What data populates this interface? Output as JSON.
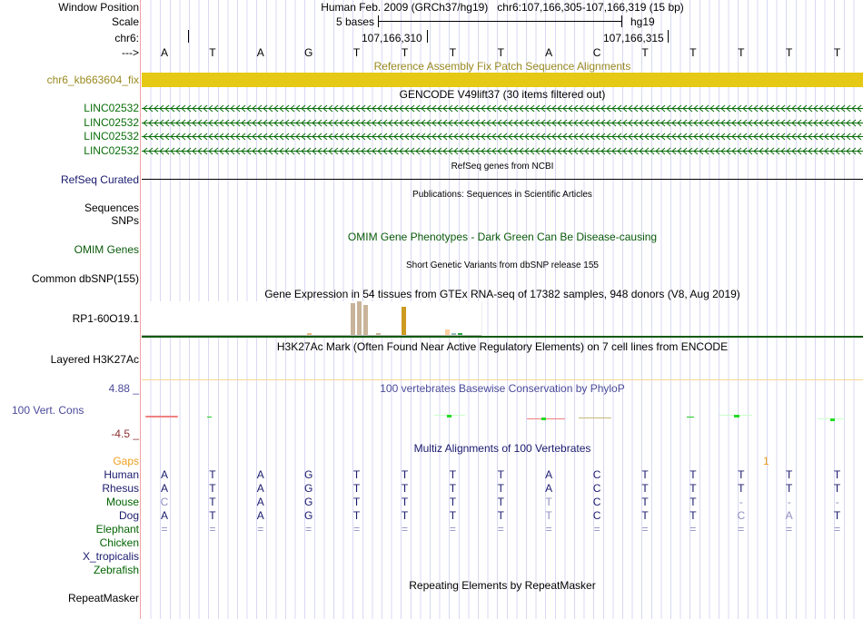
{
  "header": {
    "window_position_label": "Window Position",
    "window_position": "Human Feb. 2009 (GRCh37/hg19)   chr6:107,166,305-107,166,319 (15 bp)",
    "scale_label": "Scale",
    "scale_text": "5 bases",
    "assembly": "hg19",
    "chrom_label": "chr6:",
    "pos1": "107,166,310",
    "pos2": "107,166,315",
    "strand_label": "--->",
    "bases": [
      "A",
      "T",
      "A",
      "G",
      "T",
      "T",
      "T",
      "T",
      "A",
      "C",
      "T",
      "T",
      "T",
      "T",
      "T"
    ]
  },
  "tracks": {
    "fix_title": "Reference Assembly Fix Patch Sequence Alignments",
    "fix_label": "chr6_kb663604_fix",
    "gencode_title": "GENCODE V49lift37 (30 items filtered out)",
    "gencode_items": [
      "LINC02532",
      "LINC02532",
      "LINC02532",
      "LINC02532"
    ],
    "refseq_title": "RefSeq genes from NCBI",
    "refseq_label": "RefSeq Curated",
    "pubs_title": "Publications: Sequences in Scientific Articles",
    "pubs_label": "Sequences",
    "snps_label": "SNPs",
    "omim_title": "OMIM Gene Phenotypes - Dark Green Can Be Disease-causing",
    "omim_label": "OMIM Genes",
    "dbsnp_title": "Short Genetic Variants from dbSNP release 155",
    "dbsnp_label": "Common dbSNP(155)",
    "gtex_title": "Gene Expression in 54 tissues from GTEx RNA-seq of 17382 samples, 948 donors (V8, Aug 2019)",
    "gtex_label": "RP1-60O19.1",
    "h3k27_title": "H3K27Ac Mark (Often Found Near Active Regulatory Elements) on 7 cell lines from ENCODE",
    "h3k27_label": "Layered H3K27Ac",
    "phylop_title": "100 vertebrates Basewise Conservation by PhyloP",
    "phylop_label": "100 Vert. Cons",
    "phylop_max": "4.88 _",
    "phylop_min": "-4.5 _",
    "multiz_title": "Multiz Alignments of 100 Vertebrates",
    "gaps_label": "Gaps",
    "gaps_value": "1",
    "repeat_title": "Repeating Elements by RepeatMasker",
    "repeat_label": "RepeatMasker"
  },
  "gtex_bars": [
    {
      "tissue_index": 26,
      "value": 0.05,
      "color": "#e8b87c"
    },
    {
      "tissue_index": 33,
      "value": 0.95,
      "color": "#c9b49a"
    },
    {
      "tissue_index": 34,
      "value": 1.0,
      "color": "#c9b49a"
    },
    {
      "tissue_index": 35,
      "value": 0.88,
      "color": "#c9b49a"
    },
    {
      "tissue_index": 37,
      "value": 0.05,
      "color": "#c9b49a"
    },
    {
      "tissue_index": 41,
      "value": 0.85,
      "color": "#cc9a20"
    },
    {
      "tissue_index": 48,
      "value": 0.15,
      "color": "#ffd0a0"
    },
    {
      "tissue_index": 49,
      "value": 0.04,
      "color": "#99bbbb"
    },
    {
      "tissue_index": 50,
      "value": 0.05,
      "color": "#22aa44"
    }
  ],
  "multiz": [
    {
      "species": "Human",
      "color": "#1a1a6e",
      "bases": [
        "A",
        "T",
        "A",
        "G",
        "T",
        "T",
        "T",
        "T",
        "A",
        "C",
        "T",
        "T",
        "T",
        "T",
        "T"
      ],
      "faded": []
    },
    {
      "species": "Rhesus",
      "color": "#1a1a6e",
      "bases": [
        "A",
        "T",
        "A",
        "G",
        "T",
        "T",
        "T",
        "T",
        "A",
        "C",
        "T",
        "T",
        "T",
        "T",
        "T"
      ],
      "faded": []
    },
    {
      "species": "Mouse",
      "color": "#006400",
      "bases": [
        "C",
        "T",
        "A",
        "G",
        "T",
        "T",
        "T",
        "T",
        "T",
        "C",
        "T",
        "T",
        "-",
        "-",
        "-"
      ],
      "faded": [
        0,
        8,
        12,
        13,
        14
      ]
    },
    {
      "species": "Dog",
      "color": "#1a1a6e",
      "bases": [
        "A",
        "T",
        "A",
        "G",
        "T",
        "T",
        "T",
        "T",
        "T",
        "C",
        "T",
        "T",
        "C",
        "A",
        "T"
      ],
      "faded": [
        8,
        12,
        13
      ]
    },
    {
      "species": "Elephant",
      "color": "#006400",
      "bases": [
        "=",
        "=",
        "=",
        "=",
        "=",
        "=",
        "=",
        "=",
        "=",
        "=",
        "=",
        "=",
        "=",
        "=",
        "="
      ],
      "faded": [
        0,
        1,
        2,
        3,
        4,
        5,
        6,
        7,
        8,
        9,
        10,
        11,
        12,
        13,
        14
      ]
    },
    {
      "species": "Chicken",
      "color": "#006400",
      "bases": [],
      "faded": []
    },
    {
      "species": "X_tropicalis",
      "color": "#1a1a6e",
      "bases": [],
      "faded": []
    },
    {
      "species": "Zebrafish",
      "color": "#006400",
      "bases": [],
      "faded": []
    }
  ],
  "colors": {
    "fix": "#9a8a20",
    "gencode": "#0a6e0a",
    "refseq": "#1a1a6e",
    "omim": "#0a5a0a",
    "phylop": "#4a4a9a",
    "phylop_min": "#8b3030",
    "gaps": "#f0a020"
  }
}
